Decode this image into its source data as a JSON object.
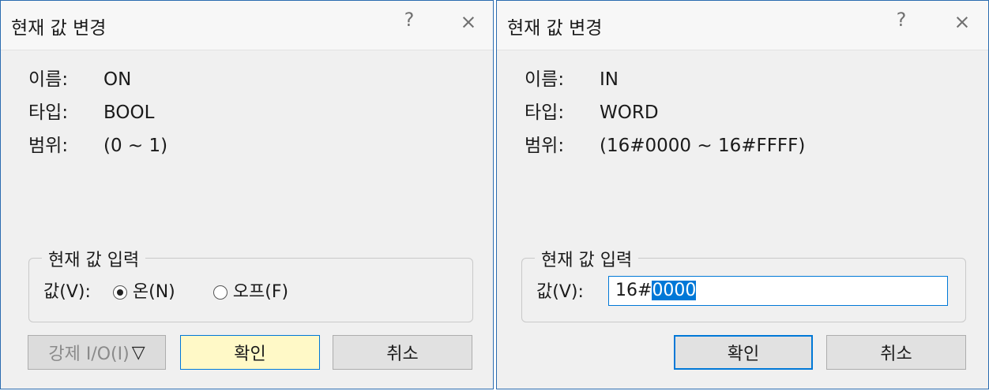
{
  "dialog_bool": {
    "title": "현재 값 변경",
    "help": "?",
    "close": "×",
    "name_label": "이름:",
    "name_value": "ON",
    "type_label": "타입:",
    "type_value": "BOOL",
    "range_label": "범위:",
    "range_value": "(0 ~ 1)",
    "group_title": "현재 값 입력",
    "value_label": "값(V):",
    "option_on": "온(N)",
    "option_off": "오프(F)",
    "force_io_label": "강제 I/O(I)",
    "force_io_arrow": "▽",
    "ok_label": "확인",
    "cancel_label": "취소"
  },
  "dialog_word": {
    "title": "현재 값 변경",
    "help": "?",
    "close": "×",
    "name_label": "이름:",
    "name_value": "IN",
    "type_label": "타입:",
    "type_value": "WORD",
    "range_label": "범위:",
    "range_value": "(16#0000 ~ 16#FFFF)",
    "group_title": "현재 값 입력",
    "value_label": "값(V):",
    "value_prefix": "16#",
    "value_selected": "0000",
    "ok_label": "확인",
    "cancel_label": "취소"
  },
  "colors": {
    "accent": "#0078d7",
    "ok_button_bg": "#fff9c7"
  }
}
